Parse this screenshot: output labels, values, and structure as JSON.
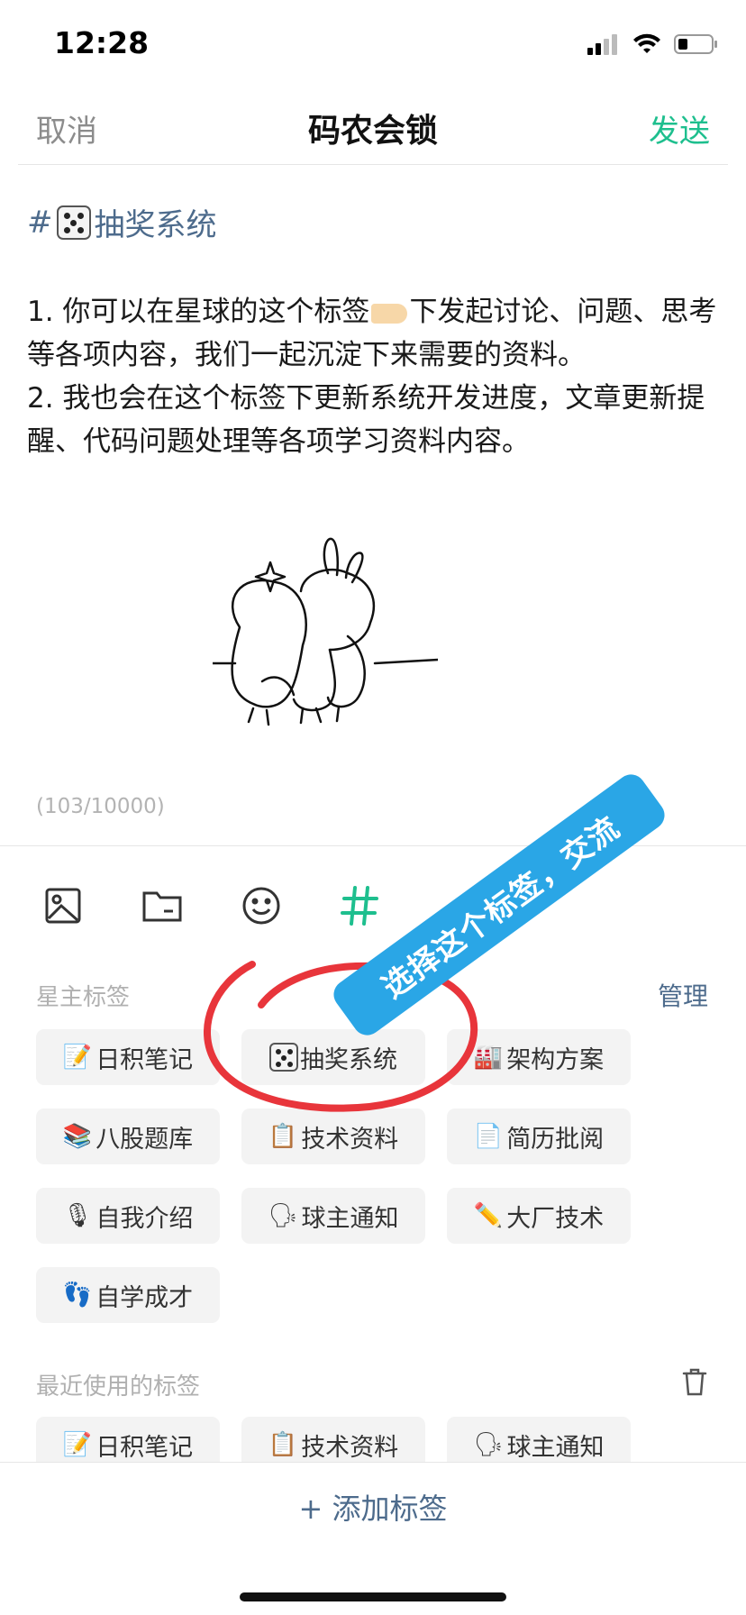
{
  "status": {
    "time": "12:28"
  },
  "nav": {
    "cancel": "取消",
    "title": "码农会锁",
    "send": "发送"
  },
  "post": {
    "hashtag_prefix": "#",
    "hashtag_name": "抽奖系统",
    "line1_a": "1. 你可以在星球的这个标签",
    "line1_b": "下发起讨论、问题、思考等各项内容，我们一起沉淀下来需要的资料。",
    "line2": "2. 我也会在这个标签下更新系统开发进度，文章更新提醒、代码问题处理等各项学习资料内容。",
    "char_count": "(103/10000)"
  },
  "toolbar": {
    "icons": [
      "image-icon",
      "folder-icon",
      "emoji-icon",
      "hashtag-icon"
    ]
  },
  "owner_tags": {
    "title": "星主标签",
    "manage": "管理",
    "items": [
      {
        "icon": "📝",
        "label": "日积笔记"
      },
      {
        "icon": "dice",
        "label": "抽奖系统"
      },
      {
        "icon": "🏭",
        "label": "架构方案"
      },
      {
        "icon": "📚",
        "label": "八股题库"
      },
      {
        "icon": "📋",
        "label": "技术资料"
      },
      {
        "icon": "📄",
        "label": "简历批阅"
      },
      {
        "icon": "🎙",
        "label": "自我介绍"
      },
      {
        "icon": "🗣",
        "label": "球主通知"
      },
      {
        "icon": "✏️",
        "label": "大厂技术"
      },
      {
        "icon": "👣",
        "label": "自学成才"
      }
    ]
  },
  "recent_tags": {
    "title": "最近使用的标签",
    "items": [
      {
        "icon": "📝",
        "label": "日积笔记"
      },
      {
        "icon": "📋",
        "label": "技术资料"
      },
      {
        "icon": "🗣",
        "label": "球主通知"
      }
    ]
  },
  "bottom": {
    "plus": "+",
    "add_tag": "添加标签"
  },
  "annotation": {
    "text": "选择这个标签，交流",
    "banner_color": "#2aa6e6",
    "circle_color": "#e8353b"
  },
  "colors": {
    "accent": "#1ebf8e",
    "link": "#4d6b8c"
  }
}
